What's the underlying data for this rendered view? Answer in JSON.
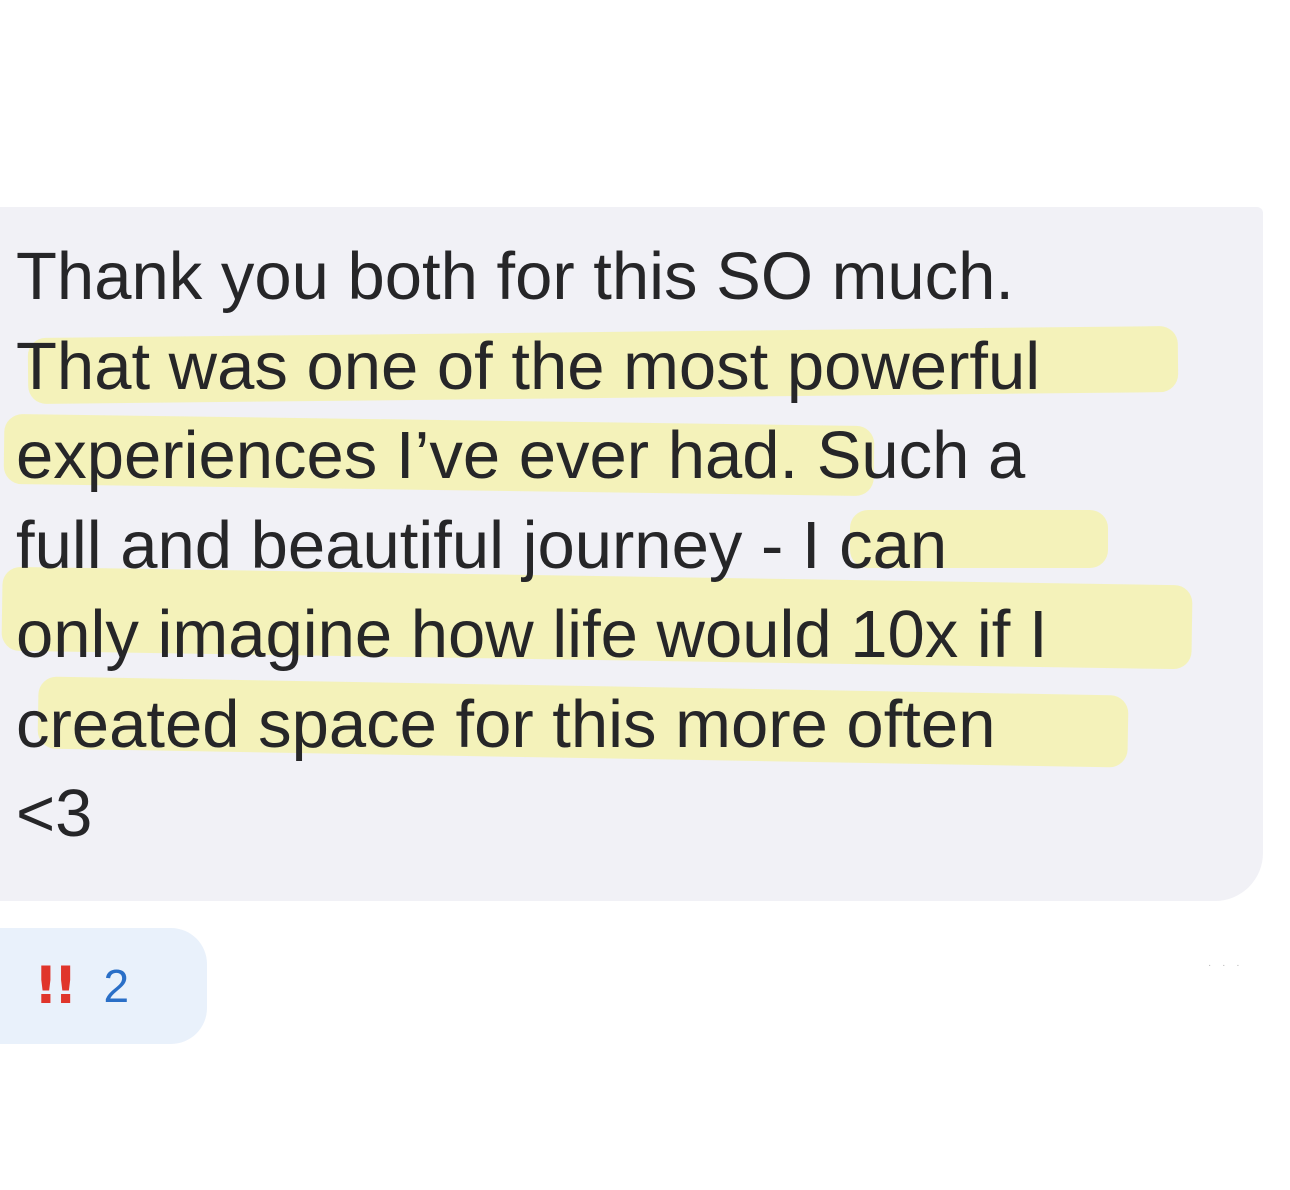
{
  "message": {
    "lines": [
      "Thank you both for this SO much.",
      "That was one of the most powerful",
      "experiences I’ve ever had. Such a",
      "full and beautiful journey - I can",
      "only imagine how life would 10x if I",
      "created space for this more often",
      "<3"
    ]
  },
  "reaction": {
    "icon": "double-exclamation-icon",
    "symbol": "!!",
    "count": "2"
  },
  "colors": {
    "bubble": "#f1f1f6",
    "highlight": "#f4f1a6",
    "reaction_bg": "#e9f1fb",
    "reaction_icon": "#e0352b",
    "reaction_count": "#2a6fc7"
  }
}
